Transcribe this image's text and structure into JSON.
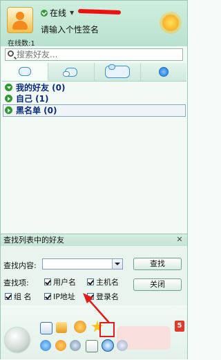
{
  "header": {
    "status": "在线",
    "signature": "请输入个性签名",
    "online_count": "在线数:1"
  },
  "search": {
    "placeholder": "搜索好友..."
  },
  "tabs": [
    {
      "icon": "chat-bubble-icon"
    },
    {
      "icon": "group-chat-icon"
    },
    {
      "icon": "contacts-icon"
    },
    {
      "icon": "globe-icon"
    }
  ],
  "groups": [
    {
      "label": "我的好友 (0)",
      "expanded": true
    },
    {
      "label": "自己 (1)",
      "expanded": false
    },
    {
      "label": "黑名单 (0)",
      "expanded": false
    }
  ],
  "find": {
    "title": "查找列表中的好友",
    "content_label": "查找内容:",
    "items_label": "查找项:",
    "search_button": "查找",
    "close_button": "关闭",
    "options": {
      "username": "用户名",
      "hostname": "主机名",
      "group": "组 名",
      "ip": "IP地址",
      "login": "登录名"
    }
  },
  "toolbar": {
    "badge": "5"
  },
  "colors": {
    "accent_green": "#2f9b2f",
    "group_text": "#0a2a7d",
    "highlight_red": "#e21a1a"
  }
}
